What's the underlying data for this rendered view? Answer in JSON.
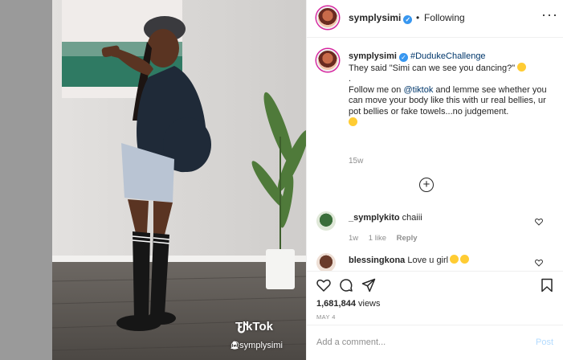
{
  "post": {
    "username": "symplysimi",
    "follow_dot": "•",
    "follow_status": "Following",
    "more_icon": "more-horizontal-icon",
    "close_icon": "close-icon"
  },
  "caption": {
    "username": "symplysimi",
    "hashtag": "#DudukeChallenge",
    "line1": "They said \"Simi can we see you dancing?\"",
    "dot": ".",
    "line2_pre": "Follow me on ",
    "mention": "@tiktok",
    "line2_post": " and lemme see whether you can move your body like this with ur real bellies, ur pot bellies or fake towels...no judgement.",
    "time": "15w"
  },
  "load_more_icon": "plus-circle-icon",
  "comments": [
    {
      "username": "_symplykito",
      "text": "chaiii",
      "time": "1w",
      "likes": "1 like",
      "reply": "Reply"
    },
    {
      "username": "blessingkona",
      "text": "Love u girl"
    }
  ],
  "actions": {
    "views_count": "1,681,844",
    "views_label": " views",
    "date": "MAY 4"
  },
  "comment_box": {
    "placeholder": "Add a comment...",
    "post_label": "Post"
  },
  "video": {
    "watermark": "TikTok",
    "handle": "@symplysimi"
  },
  "colors": {
    "link": "#00376b",
    "verified": "#3897f0",
    "post_disabled": "#b3dbff"
  }
}
